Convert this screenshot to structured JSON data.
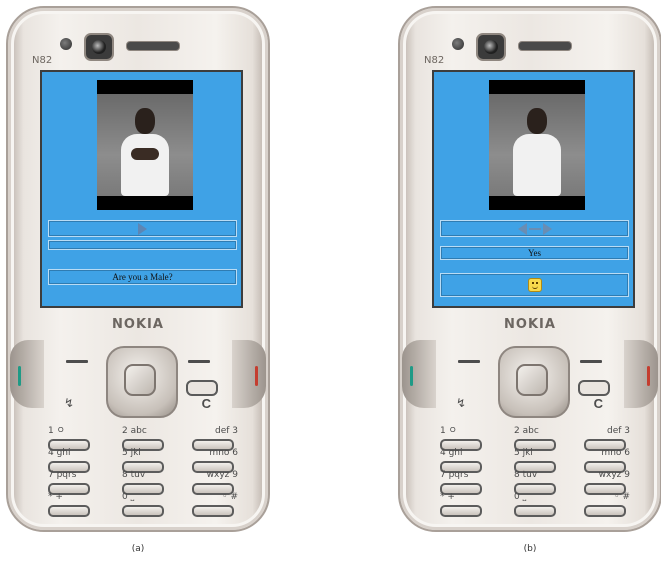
{
  "figure": {
    "phones": [
      {
        "model": "N82",
        "brand": "NOKIA",
        "screen": {
          "message": "Are you a Male?",
          "response": "",
          "icon": "play-icon"
        },
        "keys": {
          "menu_symbol": "↯",
          "clear": "C"
        },
        "caption": "(a)"
      },
      {
        "model": "N82",
        "brand": "NOKIA",
        "screen": {
          "message": "",
          "response": "Yes",
          "icon": "nav-arrows-icon",
          "feedback_icon": "smiley-icon"
        },
        "keys": {
          "menu_symbol": "↯",
          "clear": "C"
        },
        "caption": "(b)"
      }
    ],
    "keypad": [
      {
        "left": "1 ㅇ",
        "right": ""
      },
      {
        "left": "2 abc",
        "right": ""
      },
      {
        "left": "",
        "right": "def 3"
      },
      {
        "left": "4 ghi",
        "right": ""
      },
      {
        "left": "5 jkl",
        "right": ""
      },
      {
        "left": "",
        "right": "mno 6"
      },
      {
        "left": "7 pqrs",
        "right": ""
      },
      {
        "left": "8 tuv",
        "right": ""
      },
      {
        "left": "",
        "right": "wxyz 9"
      },
      {
        "left": "* +",
        "right": ""
      },
      {
        "left": "0 ⎵",
        "right": ""
      },
      {
        "left": "",
        "right": "◦ #"
      }
    ],
    "colors": {
      "screen": "#3fa2e6",
      "body": "#ece7e2",
      "call_green": "#1f9a86",
      "call_red": "#c43d2f"
    }
  }
}
